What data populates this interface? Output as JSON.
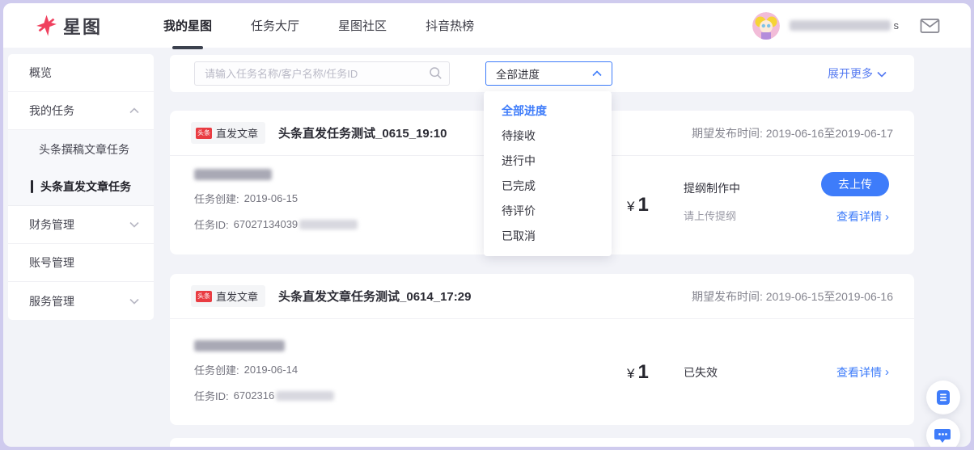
{
  "colors": {
    "accent_blue": "#3e7cfa",
    "brand_red": "#f0415f",
    "badge_red": "#e93c42",
    "link_blue": "#5479f1"
  },
  "navbar": {
    "logo_text": "星图",
    "tabs": [
      {
        "label": "我的星图",
        "active": true
      },
      {
        "label": "任务大厅",
        "active": false
      },
      {
        "label": "星图社区",
        "active": false
      },
      {
        "label": "抖音热榜",
        "active": false
      }
    ],
    "user": {
      "name_suffix": "s"
    }
  },
  "sidebar": {
    "items": [
      {
        "label": "概览"
      },
      {
        "label": "我的任务",
        "expanded": true
      },
      {
        "label": "头条撰稿文章任务",
        "sub": true
      },
      {
        "label": "头条直发文章任务",
        "sub": true,
        "active": true
      },
      {
        "label": "财务管理",
        "collapsible": true
      },
      {
        "label": "账号管理"
      },
      {
        "label": "服务管理",
        "collapsible": true
      }
    ]
  },
  "filters": {
    "search_placeholder": "请输入任务名称/客户名称/任务ID",
    "progress_selected": "全部进度",
    "expand_more": "展开更多",
    "progress_options": [
      "全部进度",
      "待接收",
      "进行中",
      "已完成",
      "待评价",
      "已取消"
    ]
  },
  "tasks": [
    {
      "platform_badge": "头条",
      "type_badge": "直发文章",
      "title": "头条直发任务测试_0615_19:10",
      "publish_label": "期望发布时间:",
      "publish_range": "2019-06-16至2019-06-17",
      "created_label": "任务创建:",
      "created_date": "2019-06-15",
      "id_label": "任务ID:",
      "id_visible": "67027134039",
      "currency": "¥",
      "price": "1",
      "status": "提纲制作中",
      "status_hint": "请上传提纲",
      "action_label": "去上传",
      "detail_label": "查看详情",
      "detail_chevron": "›"
    },
    {
      "platform_badge": "头条",
      "type_badge": "直发文章",
      "title": "头条直发文章任务测试_0614_17:29",
      "publish_label": "期望发布时间:",
      "publish_range": "2019-06-15至2019-06-16",
      "created_label": "任务创建:",
      "created_date": "2019-06-14",
      "id_label": "任务ID:",
      "id_visible": "6702316",
      "currency": "¥",
      "price": "1",
      "status": "已失效",
      "detail_label": "查看详情",
      "detail_chevron": "›"
    }
  ]
}
